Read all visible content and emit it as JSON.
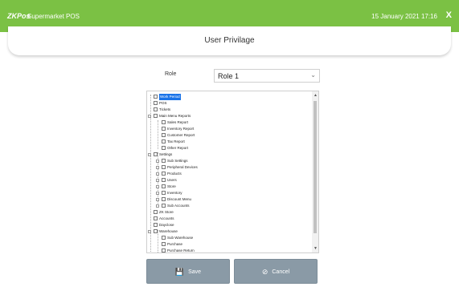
{
  "topbar": {
    "brand": "ZKPos",
    "app_title": "Supermarket POS",
    "datetime": "15 January 2021 17:16",
    "close": "X"
  },
  "page": {
    "title": "User Privilage"
  },
  "role": {
    "label": "Role",
    "value": "Role 1"
  },
  "tree": {
    "items": [
      {
        "label": "Work Period"
      },
      {
        "label": "POS"
      },
      {
        "label": "Tickets"
      },
      {
        "label": "Main Menu Reports"
      },
      {
        "label": "Sales Report"
      },
      {
        "label": "Inventory Report"
      },
      {
        "label": "Customer Report"
      },
      {
        "label": "Tax Report"
      },
      {
        "label": "Other Report"
      },
      {
        "label": "Settings"
      },
      {
        "label": "Sub Settings"
      },
      {
        "label": "Peripheral Devices"
      },
      {
        "label": "Products"
      },
      {
        "label": "Users"
      },
      {
        "label": "Store"
      },
      {
        "label": "Inventory"
      },
      {
        "label": "Discount Menu"
      },
      {
        "label": "Sub Accounts"
      },
      {
        "label": "ZK Store"
      },
      {
        "label": "Accounts"
      },
      {
        "label": "Dayclose"
      },
      {
        "label": "Warehouse"
      },
      {
        "label": "Sub Warehouse"
      },
      {
        "label": "Purchase"
      },
      {
        "label": "Purchase Return"
      }
    ]
  },
  "buttons": {
    "save": "Save",
    "cancel": "Cancel"
  },
  "icons": {
    "save": "floppy-disk-icon",
    "cancel": "cancel-circle-icon",
    "dropdown": "chevron-down-icon"
  },
  "colors": {
    "topbar": "#7bc144",
    "button": "#8a9aa6",
    "selection": "#1a73e8"
  }
}
